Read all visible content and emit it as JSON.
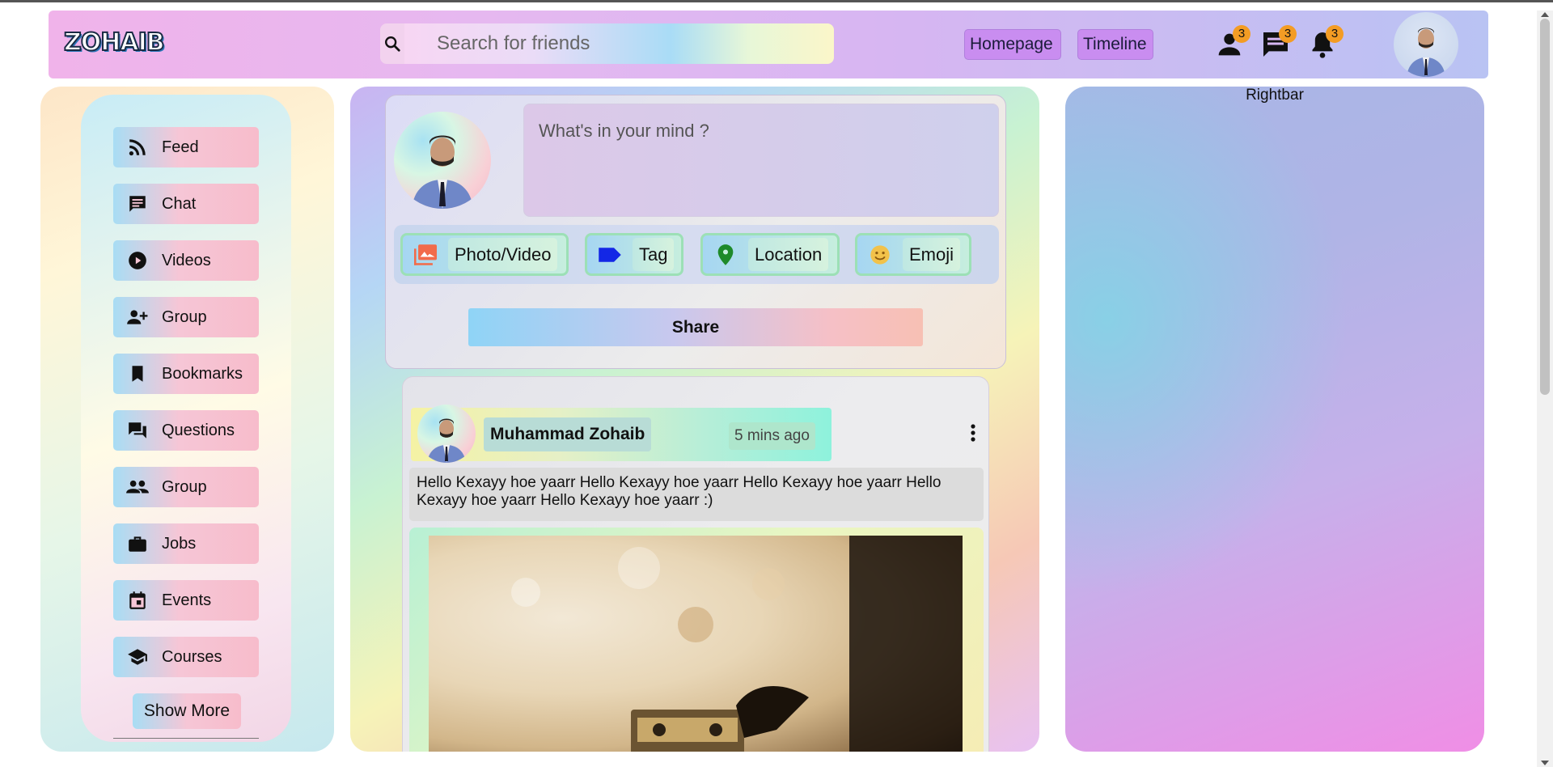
{
  "brand": {
    "logo_text": "ZOHAIB"
  },
  "search": {
    "placeholder": "Search for friends",
    "icon": "search-icon"
  },
  "nav": {
    "homepage": "Homepage",
    "timeline": "Timeline"
  },
  "notifications": [
    {
      "icon": "person-icon",
      "count": "3"
    },
    {
      "icon": "chat-icon",
      "count": "3"
    },
    {
      "icon": "bell-icon",
      "count": "3"
    }
  ],
  "sidebar": {
    "items": [
      {
        "label": "Feed",
        "icon": "rss-feed-icon"
      },
      {
        "label": "Chat",
        "icon": "chat-icon"
      },
      {
        "label": "Videos",
        "icon": "play-circle-icon"
      },
      {
        "label": "Group",
        "icon": "group-add-icon"
      },
      {
        "label": "Bookmarks",
        "icon": "bookmark-icon"
      },
      {
        "label": "Questions",
        "icon": "forum-icon"
      },
      {
        "label": "Group",
        "icon": "people-icon"
      },
      {
        "label": "Jobs",
        "icon": "briefcase-icon"
      },
      {
        "label": "Events",
        "icon": "calendar-icon"
      },
      {
        "label": "Courses",
        "icon": "school-icon"
      }
    ],
    "show_more": "Show More"
  },
  "composer": {
    "placeholder": "What's in your mind ?",
    "options": [
      {
        "label": "Photo/Video",
        "icon": "photo-library-icon"
      },
      {
        "label": "Tag",
        "icon": "label-icon"
      },
      {
        "label": "Location",
        "icon": "location-pin-icon"
      },
      {
        "label": "Emoji",
        "icon": "emoji-icon"
      }
    ],
    "share": "Share"
  },
  "post": {
    "author": "Muhammad Zohaib",
    "time": "5 mins ago",
    "text": "Hello Kexayy hoe yaarr Hello Kexayy hoe yaarr Hello Kexayy hoe yaarr Hello Kexayy hoe yaarr Hello Kexayy hoe yaarr :)"
  },
  "rightbar": {
    "title": "Rightbar"
  }
}
